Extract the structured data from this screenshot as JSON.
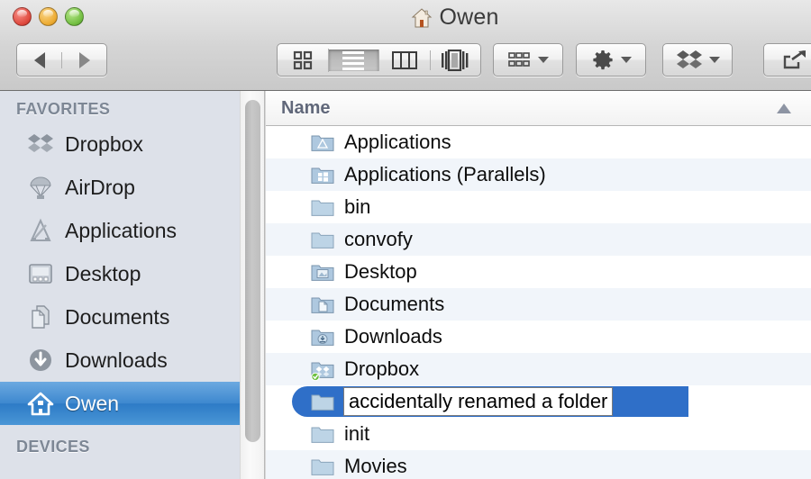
{
  "window": {
    "title": "Owen",
    "title_icon": "home-icon",
    "traffic_lights": [
      {
        "name": "close",
        "color": "#e04b40"
      },
      {
        "name": "minimize",
        "color": "#edac33"
      },
      {
        "name": "maximize",
        "color": "#74c043"
      }
    ]
  },
  "toolbar": {
    "back_label": "Back",
    "forward_label": "Forward",
    "view_modes": [
      {
        "name": "icon-view",
        "label": "Icon View",
        "active": false
      },
      {
        "name": "list-view",
        "label": "List View",
        "active": true
      },
      {
        "name": "column-view",
        "label": "Column View",
        "active": false
      },
      {
        "name": "coverflow-view",
        "label": "Cover Flow View",
        "active": false
      }
    ],
    "arrange_label": "Arrange",
    "action_label": "Action",
    "dropbox_label": "Dropbox",
    "share_label": "Share"
  },
  "sidebar": {
    "sections": [
      {
        "header": "FAVORITES",
        "items": [
          {
            "label": "Dropbox",
            "icon": "dropbox-icon",
            "selected": false
          },
          {
            "label": "AirDrop",
            "icon": "airdrop-icon",
            "selected": false
          },
          {
            "label": "Applications",
            "icon": "applications-icon",
            "selected": false
          },
          {
            "label": "Desktop",
            "icon": "desktop-icon",
            "selected": false
          },
          {
            "label": "Documents",
            "icon": "documents-icon",
            "selected": false
          },
          {
            "label": "Downloads",
            "icon": "downloads-icon",
            "selected": false
          },
          {
            "label": "Owen",
            "icon": "home-icon",
            "selected": true
          }
        ]
      },
      {
        "header": "DEVICES",
        "items": []
      }
    ]
  },
  "filelist": {
    "column_header": "Name",
    "sort_direction": "ascending",
    "rows": [
      {
        "name": "Applications",
        "icon": "folder-applications-icon",
        "badge": null,
        "editing": false
      },
      {
        "name": "Applications (Parallels)",
        "icon": "folder-windows-icon",
        "badge": null,
        "editing": false
      },
      {
        "name": "bin",
        "icon": "folder-icon",
        "badge": null,
        "editing": false
      },
      {
        "name": "convofy",
        "icon": "folder-icon",
        "badge": null,
        "editing": false
      },
      {
        "name": "Desktop",
        "icon": "folder-desktop-icon",
        "badge": null,
        "editing": false
      },
      {
        "name": "Documents",
        "icon": "folder-documents-icon",
        "badge": null,
        "editing": false
      },
      {
        "name": "Downloads",
        "icon": "folder-downloads-icon",
        "badge": null,
        "editing": false
      },
      {
        "name": "Dropbox",
        "icon": "folder-dropbox-icon",
        "badge": "sync-check",
        "editing": false
      },
      {
        "name": "accidentally renamed a folder",
        "icon": "folder-icon",
        "badge": null,
        "editing": true
      },
      {
        "name": "init",
        "icon": "folder-icon",
        "badge": null,
        "editing": false
      },
      {
        "name": "Movies",
        "icon": "folder-icon",
        "badge": null,
        "editing": false
      }
    ]
  },
  "colors": {
    "selection_blue": "#2f6fc8",
    "sidebar_bg": "#dde1e9",
    "row_stripe": "#f1f5fa",
    "folder_blue": "#b6cde0"
  }
}
